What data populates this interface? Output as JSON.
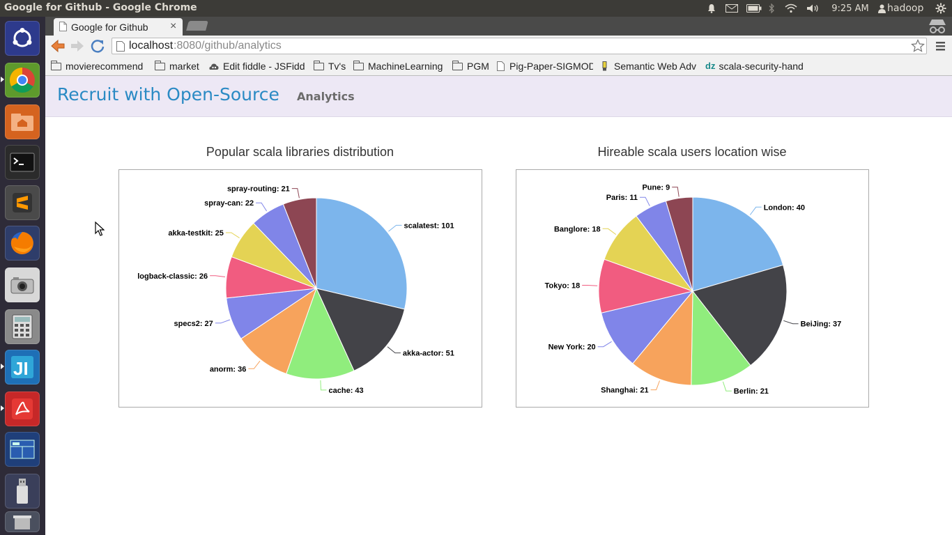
{
  "window": {
    "title": "Google for Github - Google Chrome"
  },
  "panel": {
    "time": "9:25 AM",
    "user": "hadoop"
  },
  "browser": {
    "tab_title": "Google for Github",
    "tab_close": "×",
    "url_host": "localhost",
    "url_rest": ":8080/github/analytics",
    "bookmarks": [
      {
        "label": "movierecommend",
        "icon": "folder-icon"
      },
      {
        "label": "market",
        "icon": "folder-icon"
      },
      {
        "label": "Edit fiddle - JSFidd",
        "icon": "jsfiddle-icon"
      },
      {
        "label": "Tv's",
        "icon": "folder-icon"
      },
      {
        "label": "MachineLearning",
        "icon": "folder-icon"
      },
      {
        "label": "PGM",
        "icon": "folder-icon"
      },
      {
        "label": "Pig-Paper-SIGMOD",
        "icon": "page-icon"
      },
      {
        "label": "Semantic Web Adv",
        "icon": "bookmarklet-icon"
      },
      {
        "label": "scala-security-hand",
        "icon": "dzone-icon"
      }
    ]
  },
  "app": {
    "brand": "Recruit with Open-Source",
    "nav_analytics": "Analytics"
  },
  "chart_data": [
    {
      "type": "pie",
      "title": "Popular scala libraries distribution",
      "slices": [
        {
          "label": "scalatest",
          "value": 101,
          "color": "#7cb5ec"
        },
        {
          "label": "akka-actor",
          "value": 51,
          "color": "#434348"
        },
        {
          "label": "cache",
          "value": 43,
          "color": "#90ed7d"
        },
        {
          "label": "anorm",
          "value": 36,
          "color": "#f7a35c"
        },
        {
          "label": "specs2",
          "value": 27,
          "color": "#8085e9"
        },
        {
          "label": "logback-classic",
          "value": 26,
          "color": "#f15c80"
        },
        {
          "label": "akka-testkit",
          "value": 25,
          "color": "#e4d354"
        },
        {
          "label": "spray-can",
          "value": 22,
          "color": "#8085e8"
        },
        {
          "label": "spray-routing",
          "value": 21,
          "color": "#8d4653"
        }
      ]
    },
    {
      "type": "pie",
      "title": "Hireable scala users location wise",
      "slices": [
        {
          "label": "London",
          "value": 40,
          "color": "#7cb5ec"
        },
        {
          "label": "BeiJing",
          "value": 37,
          "color": "#434348"
        },
        {
          "label": "Berlin",
          "value": 21,
          "color": "#90ed7d"
        },
        {
          "label": "Shanghai",
          "value": 21,
          "color": "#f7a35c"
        },
        {
          "label": "New York",
          "value": 20,
          "color": "#8085e9"
        },
        {
          "label": "Tokyo",
          "value": 18,
          "color": "#f15c80"
        },
        {
          "label": "Banglore",
          "value": 18,
          "color": "#e4d354"
        },
        {
          "label": "Paris",
          "value": 11,
          "color": "#8085e8"
        },
        {
          "label": "Pune",
          "value": 9,
          "color": "#8d4653"
        }
      ]
    }
  ]
}
